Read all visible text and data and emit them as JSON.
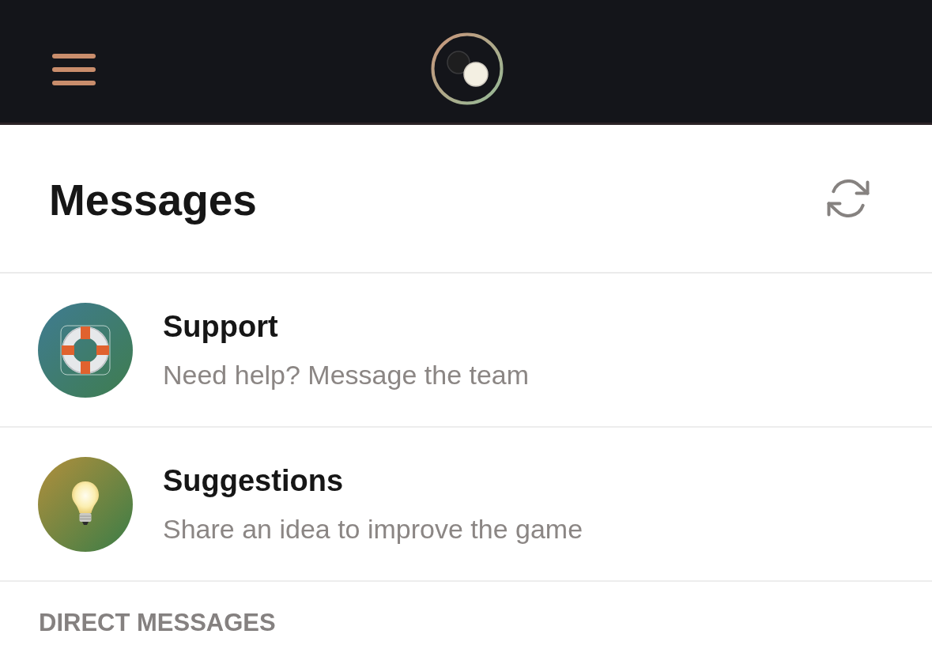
{
  "page": {
    "title": "Messages"
  },
  "channels": [
    {
      "kind": "lifebuoy",
      "title": "Support",
      "subtitle": "Need help? Message the team"
    },
    {
      "kind": "bulb",
      "title": "Suggestions",
      "subtitle": "Share an idea to improve the game"
    }
  ],
  "section": {
    "heading": "DIRECT MESSAGES"
  }
}
